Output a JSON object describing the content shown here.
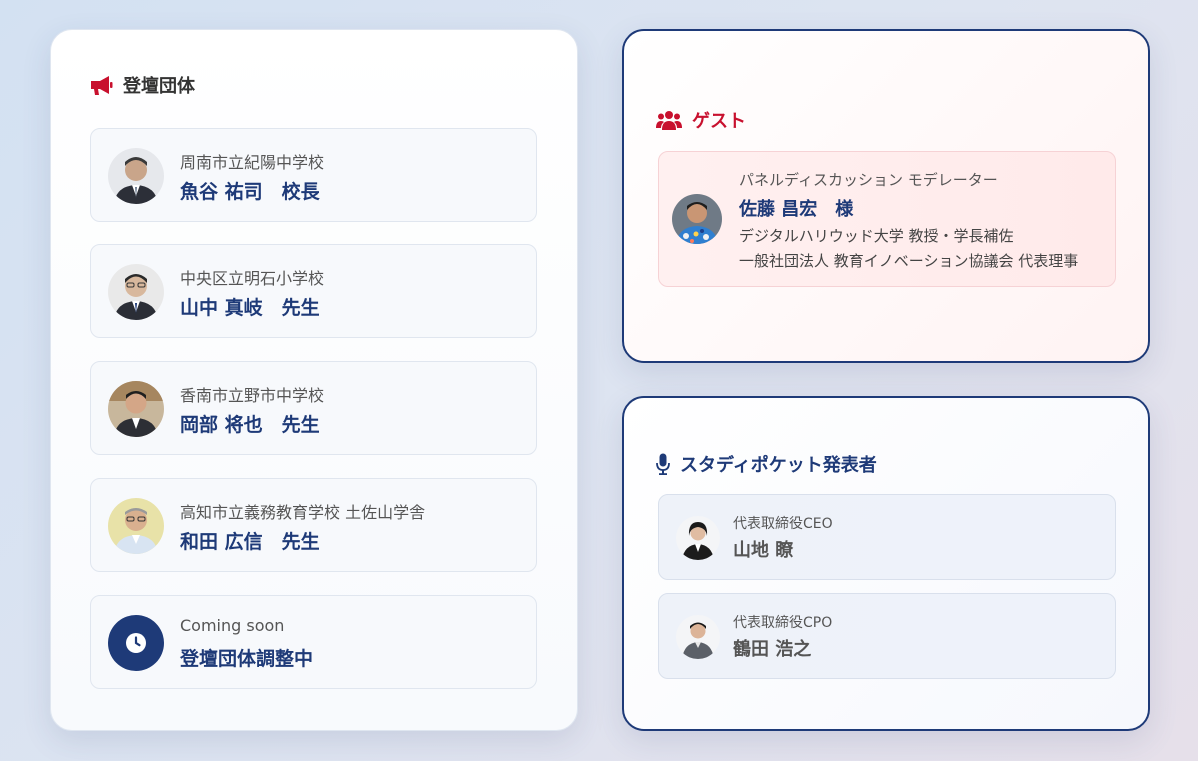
{
  "organizations": {
    "heading": "登壇団体",
    "members": [
      {
        "school": "周南市立紀陽中学校",
        "name": "魚谷 祐司　校長"
      },
      {
        "school": "中央区立明石小学校",
        "name": "山中 真岐　先生"
      },
      {
        "school": "香南市立野市中学校",
        "name": "岡部 将也　先生"
      },
      {
        "school": "高知市立義務教育学校 土佐山学舎",
        "name": "和田 広信　先生"
      },
      {
        "school": "Coming soon",
        "name": "登壇団体調整中"
      }
    ]
  },
  "guest": {
    "heading": "ゲスト",
    "role": "パネルディスカッション モデレーター",
    "name": "佐藤 昌宏　様",
    "affiliation1": "デジタルハリウッド大学 教授・学長補佐",
    "affiliation2": "一般社団法人 教育イノベーション協議会 代表理事"
  },
  "presenters": {
    "heading": "スタディポケット発表者",
    "people": [
      {
        "title": "代表取締役CEO",
        "name": "山地 瞭"
      },
      {
        "title": "代表取締役CPO",
        "name": "鶴田 浩之"
      }
    ]
  },
  "icons": {
    "organizations": "megaphone-icon",
    "guest": "users-icon",
    "presenters": "microphone-icon",
    "coming_soon": "clock-icon"
  },
  "colors": {
    "navy": "#1e3a78",
    "red": "#c8102e"
  }
}
